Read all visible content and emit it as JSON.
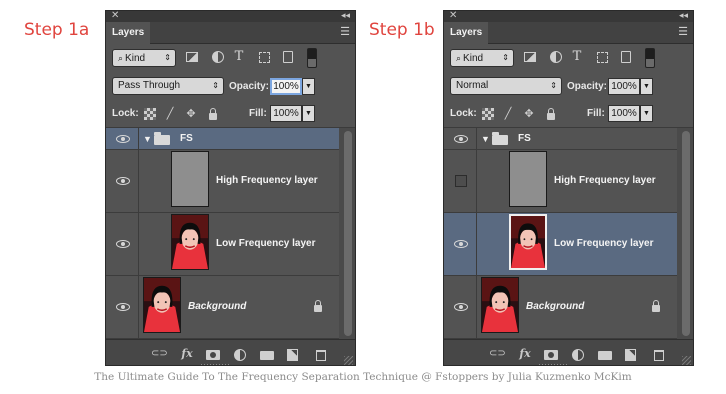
{
  "steps": [
    "Step 1a",
    "Step 1b"
  ],
  "caption": "The Ultimate Guide To The Frequency Separation Technique @ Fstoppers by Julia Kuzmenko McKim",
  "colors": {
    "step_label": "#e0443e",
    "panel_bg": "#535353",
    "selected_row": "#5a6a81",
    "titlebar": "#383838"
  },
  "icons": {
    "titlebar": [
      "close-icon",
      "collapse-icon"
    ],
    "filter": [
      "search-icon",
      "pixel-filter-icon",
      "adjustment-filter-icon",
      "type-filter-icon",
      "shape-filter-icon",
      "smart-object-filter-icon"
    ],
    "lock": [
      "lock-transparent-icon",
      "lock-image-icon",
      "lock-position-icon",
      "lock-all-icon"
    ],
    "bottom": [
      "link-icon",
      "fx-icon",
      "mask-icon",
      "adjustment-layer-icon",
      "new-group-icon",
      "new-layer-icon",
      "trash-icon"
    ]
  },
  "panel_a": {
    "tab": "Layers",
    "filter_kind": "Kind",
    "blend_mode": "Pass Through",
    "opacity_label": "Opacity:",
    "opacity": "100%",
    "lock_label": "Lock:",
    "fill_label": "Fill:",
    "fill": "100%",
    "glyphs": {
      "close": "✕",
      "collapse": "◂◂",
      "menu": "☰",
      "search": "⌕",
      "type": "T",
      "dropdown": "▼",
      "select": "⇕",
      "brush": "╱",
      "move": "✥",
      "disclosure": "▼",
      "link": "⊂⊃",
      "fx": "fx"
    },
    "layers": {
      "group": {
        "name": "FS",
        "visible": true,
        "selected": true,
        "expanded": true
      },
      "high_frequency": {
        "name": "High Frequency layer",
        "visible": true,
        "selected": false
      },
      "low_frequency": {
        "name": "Low Frequency layer",
        "visible": true,
        "selected": false
      },
      "background": {
        "name": "Background",
        "visible": true,
        "locked": true
      }
    }
  },
  "panel_b": {
    "tab": "Layers",
    "filter_kind": "Kind",
    "blend_mode": "Normal",
    "opacity_label": "Opacity:",
    "opacity": "100%",
    "lock_label": "Lock:",
    "fill_label": "Fill:",
    "fill": "100%",
    "glyphs": {
      "close": "✕",
      "collapse": "◂◂",
      "menu": "☰",
      "search": "⌕",
      "type": "T",
      "dropdown": "▼",
      "select": "⇕",
      "brush": "╱",
      "move": "✥",
      "disclosure": "▼",
      "link": "⊂⊃",
      "fx": "fx"
    },
    "layers": {
      "group": {
        "name": "FS",
        "visible": true,
        "selected": false,
        "expanded": true
      },
      "high_frequency": {
        "name": "High Frequency layer",
        "visible": false,
        "selected": false
      },
      "low_frequency": {
        "name": "Low Frequency layer",
        "visible": true,
        "selected": true
      },
      "background": {
        "name": "Background",
        "visible": true,
        "locked": true
      }
    }
  }
}
